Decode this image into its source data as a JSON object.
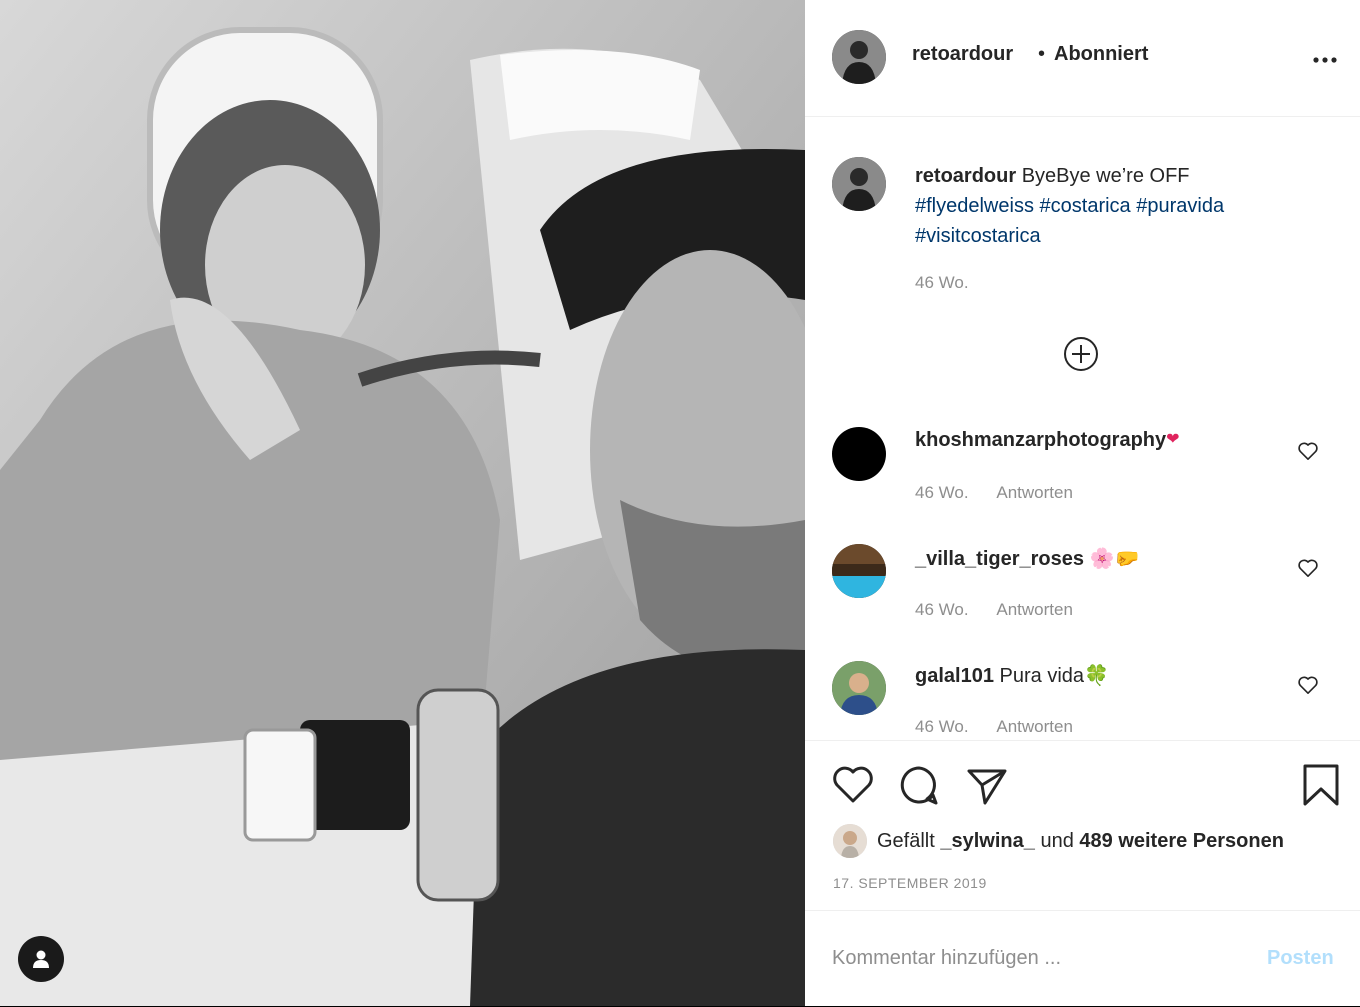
{
  "post": {
    "username": "retoardour",
    "separator": "•",
    "follow_status": "Abonniert",
    "more_icon": "more-options-icon"
  },
  "caption": {
    "username": "retoardour",
    "text": "ByeBye we’re OFF",
    "hashtags": [
      "#flyedelweiss",
      "#costarica",
      "#puravida",
      "#visitcostarica"
    ],
    "time": "46 Wo."
  },
  "load_more_icon": "plus-circle-icon",
  "comments": [
    {
      "username": "khoshmanzarphotography",
      "text": "",
      "emoji": "❤",
      "time": "46 Wo.",
      "reply": "Antworten"
    },
    {
      "username": "_villa_tiger_roses",
      "text": "",
      "emoji": "🌸🤛",
      "time": "46 Wo.",
      "reply": "Antworten"
    },
    {
      "username": "galal101",
      "text": "Pura vida",
      "emoji": "🍀",
      "time": "46 Wo.",
      "reply": "Antworten"
    }
  ],
  "likes": {
    "prefix": "Gefällt",
    "user": "_sylwina_",
    "middle": "und",
    "count_text": "489 weitere Personen"
  },
  "date": "17. SEPTEMBER 2019",
  "add_comment": {
    "placeholder": "Kommentar hinzufügen ...",
    "post_label": "Posten"
  },
  "colors": {
    "hashtag": "#00376b",
    "post_button_disabled": "#b2dffc",
    "meta_gray": "#8e8e8e"
  }
}
